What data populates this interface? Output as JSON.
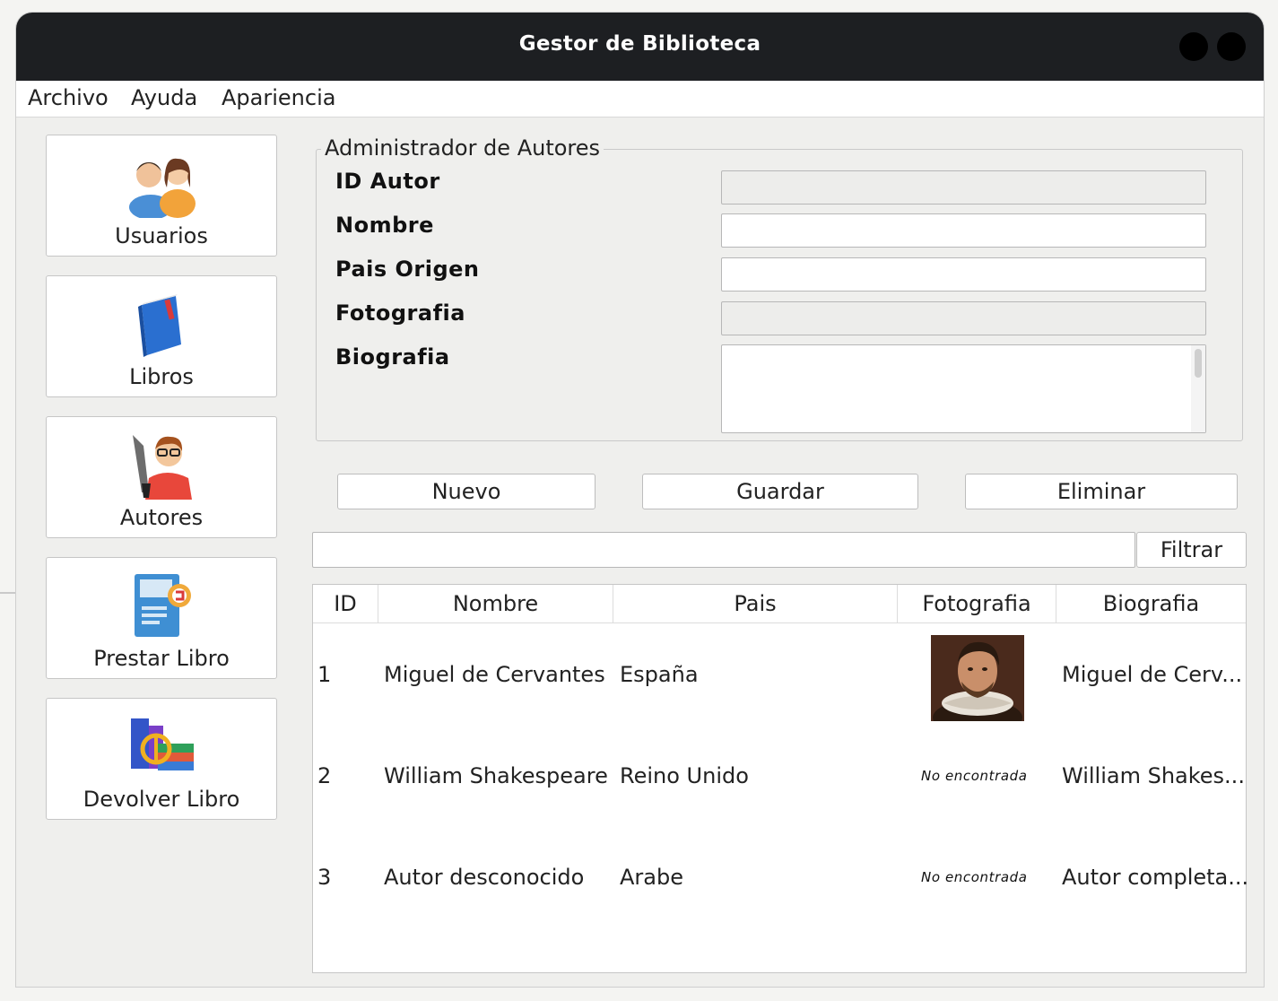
{
  "window": {
    "title": "Gestor de Biblioteca"
  },
  "menu": [
    "Archivo",
    "Ayuda",
    "Apariencia"
  ],
  "sidebar": [
    {
      "label": "Usuarios",
      "icon": "users-icon"
    },
    {
      "label": "Libros",
      "icon": "book-icon"
    },
    {
      "label": "Autores",
      "icon": "author-icon"
    },
    {
      "label": "Prestar Libro",
      "icon": "lend-book-icon"
    },
    {
      "label": "Devolver Libro",
      "icon": "return-book-icon"
    }
  ],
  "form": {
    "group_title": "Administrador de Autores",
    "fields": [
      {
        "label": "ID Autor",
        "value": ""
      },
      {
        "label": "Nombre",
        "value": ""
      },
      {
        "label": "Pais Origen",
        "value": ""
      },
      {
        "label": "Fotografia",
        "value": ""
      },
      {
        "label": "Biografia",
        "value": ""
      }
    ]
  },
  "actions": {
    "nuevo": "Nuevo",
    "guardar": "Guardar",
    "eliminar": "Eliminar"
  },
  "filter": {
    "value": "",
    "button": "Filtrar"
  },
  "table": {
    "columns": [
      "ID",
      "Nombre",
      "Pais",
      "Fotografia",
      "Biografia"
    ],
    "rows": [
      {
        "id": "1",
        "nombre": "Miguel de Cervantes",
        "pais": "España",
        "foto": "",
        "bio": "Miguel de Cerv..."
      },
      {
        "id": "2",
        "nombre": "William Shakespeare",
        "pais": "Reino Unido",
        "foto": "No encontrada",
        "bio": "William Shakes..."
      },
      {
        "id": "3",
        "nombre": "Autor desconocido",
        "pais": "Arabe",
        "foto": "No encontrada",
        "bio": "Autor completa..."
      }
    ]
  },
  "colors": {
    "titlebar": "#1d1f22",
    "accent_blue": "#3a7bd5"
  }
}
